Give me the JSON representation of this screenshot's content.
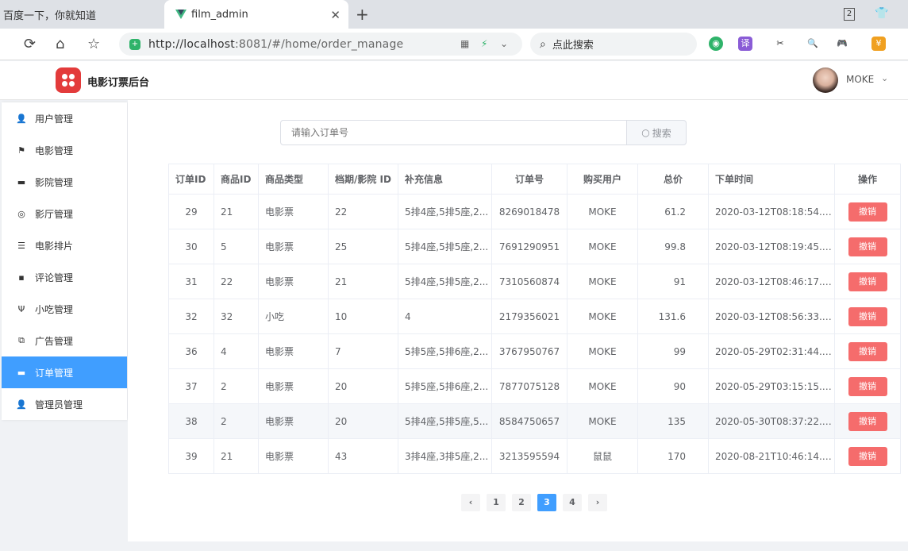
{
  "browser": {
    "inactive_tab_title": "百度一下，你就知道",
    "active_tab_title": "film_admin",
    "tab_count": "2",
    "url_host": "http://localhost",
    "url_rest": ":8081/#/home/order_manage",
    "search_placeholder": "点此搜索"
  },
  "header": {
    "app_title": "电影订票后台",
    "username": "MOKE"
  },
  "sidebar": {
    "items": [
      {
        "label": "用户管理",
        "icon": "user-icon"
      },
      {
        "label": "电影管理",
        "icon": "flag-icon"
      },
      {
        "label": "影院管理",
        "icon": "cinema-icon"
      },
      {
        "label": "影厅管理",
        "icon": "hall-icon"
      },
      {
        "label": "电影排片",
        "icon": "list-icon"
      },
      {
        "label": "评论管理",
        "icon": "comment-icon"
      },
      {
        "label": "小吃管理",
        "icon": "food-icon"
      },
      {
        "label": "广告管理",
        "icon": "ad-icon"
      },
      {
        "label": "订单管理",
        "icon": "ticket-icon"
      },
      {
        "label": "管理员管理",
        "icon": "admin-icon"
      }
    ],
    "active_index": 8
  },
  "search": {
    "placeholder": "请输入订单号",
    "button_label": "搜索"
  },
  "table": {
    "headers": [
      "订单ID",
      "商品ID",
      "商品类型",
      "档期/影院 ID",
      "补充信息",
      "订单号",
      "购买用户",
      "总价",
      "下单时间",
      "操作"
    ],
    "action_label": "撤销",
    "rows": [
      [
        "29",
        "21",
        "电影票",
        "22",
        "5排4座,5排5座,2...",
        "8269018478",
        "MOKE",
        "61.2",
        "2020-03-12T08:18:54.0..."
      ],
      [
        "30",
        "5",
        "电影票",
        "25",
        "5排4座,5排5座,2...",
        "7691290951",
        "MOKE",
        "99.8",
        "2020-03-12T08:19:45.0..."
      ],
      [
        "31",
        "22",
        "电影票",
        "21",
        "5排4座,5排5座,2...",
        "7310560874",
        "MOKE",
        "91",
        "2020-03-12T08:46:17.0..."
      ],
      [
        "32",
        "32",
        "小吃",
        "10",
        "4",
        "2179356021",
        "MOKE",
        "131.6",
        "2020-03-12T08:56:33.0..."
      ],
      [
        "36",
        "4",
        "电影票",
        "7",
        "5排5座,5排6座,2...",
        "3767950767",
        "MOKE",
        "99",
        "2020-05-29T02:31:44.0..."
      ],
      [
        "37",
        "2",
        "电影票",
        "20",
        "5排5座,5排6座,2...",
        "7877075128",
        "MOKE",
        "90",
        "2020-05-29T03:15:15.0..."
      ],
      [
        "38",
        "2",
        "电影票",
        "20",
        "5排4座,5排5座,5...",
        "8584750657",
        "MOKE",
        "135",
        "2020-05-30T08:37:22.0..."
      ],
      [
        "39",
        "21",
        "电影票",
        "43",
        "3排4座,3排5座,2...",
        "3213595594",
        "鼠鼠",
        "170",
        "2020-08-21T10:46:14.0..."
      ]
    ],
    "highlighted_row": 6
  },
  "pagination": {
    "pages": [
      "1",
      "2",
      "3",
      "4"
    ],
    "current": "3",
    "prev": "‹",
    "next": "›"
  },
  "colors": {
    "primary": "#409eff",
    "danger": "#f56c6c",
    "logo": "#e33b3b"
  }
}
